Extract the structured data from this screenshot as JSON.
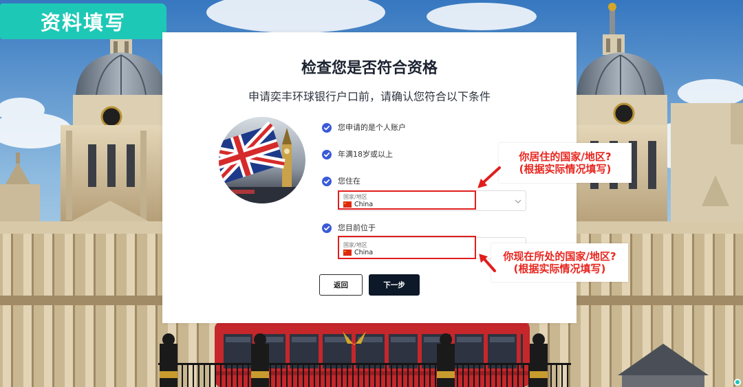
{
  "header_badge": {
    "label": "资料填写"
  },
  "eligibility_card": {
    "title": "检查您是否符合资格",
    "subtitle": "申请奕丰环球银行户口前，请确认您符合以下条件",
    "image": "uk-flag-big-ben-photo",
    "checklist": [
      {
        "label": "您申请的是个人账户",
        "icon": "check-circle-icon",
        "checked": true
      },
      {
        "label": "年满18岁或以上",
        "icon": "check-circle-icon",
        "checked": true
      },
      {
        "label": "您住在",
        "icon": "check-circle-icon",
        "checked": true
      },
      {
        "label": "您目前位于",
        "icon": "check-circle-icon",
        "checked": true
      }
    ],
    "residence_select": {
      "field_label": "国家/地区",
      "value": "China",
      "flag_icon": "china-flag-icon",
      "dropdown_icon": "chevron-down-icon"
    },
    "current_location_select": {
      "field_label": "国家/地区",
      "value": "China",
      "flag_icon": "china-flag-icon",
      "dropdown_icon": "chevron-down-icon"
    },
    "back_button": {
      "label": "返回"
    },
    "next_button": {
      "label": "下一步"
    }
  },
  "annotations": [
    {
      "line1": "你居住的国家/地区?",
      "line2": "(根据实际情况填写)"
    },
    {
      "line1": "你现在所处的国家/地区?",
      "line2": "(根据实际情况填写)"
    }
  ],
  "background": {
    "image": "greenwich-buildings-red-bus-photo"
  },
  "colors": {
    "badge": "#1ec8b6",
    "check_icon": "#3a5ad9",
    "highlight_red": "#e11d1d",
    "annotation_text": "#e8261f",
    "next_button": "#0d1829"
  }
}
